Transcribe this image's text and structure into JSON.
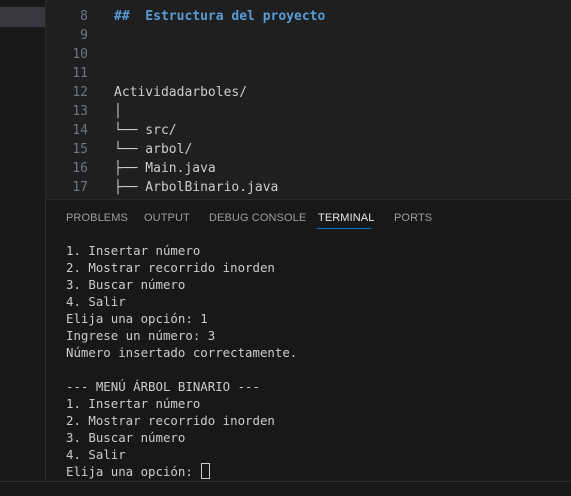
{
  "editor": {
    "lines": [
      {
        "number": "8",
        "text": "##  Estructura del proyecto",
        "style": "heading"
      },
      {
        "number": "9",
        "text": "",
        "style": "plain"
      },
      {
        "number": "10",
        "text": "",
        "style": "plain"
      },
      {
        "number": "11",
        "text": "",
        "style": "plain"
      },
      {
        "number": "12",
        "text": "Actividadarboles/",
        "style": "plain"
      },
      {
        "number": "13",
        "text": "│",
        "style": "plain"
      },
      {
        "number": "14",
        "text": "└── src/",
        "style": "plain"
      },
      {
        "number": "15",
        "text": "└── arbol/",
        "style": "plain"
      },
      {
        "number": "16",
        "text": "├── Main.java",
        "style": "plain"
      },
      {
        "number": "17",
        "text": "├── ArbolBinario.java",
        "style": "plain"
      }
    ]
  },
  "panel": {
    "tabs": [
      {
        "label": "PROBLEMS",
        "active": false
      },
      {
        "label": "OUTPUT",
        "active": false
      },
      {
        "label": "DEBUG CONSOLE",
        "active": false
      },
      {
        "label": "TERMINAL",
        "active": true
      },
      {
        "label": "PORTS",
        "active": false
      }
    ],
    "terminal_lines": [
      "1. Insertar número",
      "2. Mostrar recorrido inorden",
      "3. Buscar número",
      "4. Salir",
      "Elija una opción: 1",
      "Ingrese un número: 3",
      "Número insertado correctamente.",
      "",
      "--- MENÚ ÁRBOL BINARIO ---",
      "1. Insertar número",
      "2. Mostrar recorrido inorden",
      "3. Buscar número",
      "4. Salir",
      "Elija una opción: "
    ]
  },
  "colors": {
    "accent": "#0078d4",
    "heading": "#569cd6",
    "text": "#cccccc",
    "line_number": "#6e7681"
  }
}
